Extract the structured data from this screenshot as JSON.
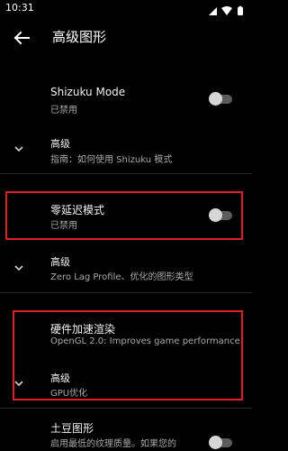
{
  "status_bar": {
    "time": "10:31",
    "icons": [
      "cell-signal-icon",
      "wifi-icon",
      "battery-icon"
    ]
  },
  "app_bar": {
    "title": "高级图形",
    "back_icon": "back-arrow-icon"
  },
  "settings": {
    "shizuku": {
      "title": "Shizuku Mode",
      "status": "已禁用",
      "enabled": false
    },
    "shizuku_advanced": {
      "title": "高级",
      "summary": "指南：如何使用 Shizuku 模式"
    },
    "zero_lag": {
      "title": "零延迟模式",
      "status": "已禁用",
      "enabled": false
    },
    "zero_lag_advanced": {
      "title": "高级",
      "summary": "Zero Lag Profile、优化的图形类型"
    },
    "hw_accel": {
      "title": "硬件加速渲染",
      "summary": "OpenGL 2.0: Improves game performance"
    },
    "hw_advanced": {
      "title": "高级",
      "summary": "GPU优化"
    },
    "potato": {
      "title": "土豆图形",
      "summary": "启用最低的纹理质量。如果您的"
    }
  },
  "colors": {
    "background": "#000000",
    "highlight": "#e11d24",
    "secondary_text": "#a9a9a9"
  }
}
